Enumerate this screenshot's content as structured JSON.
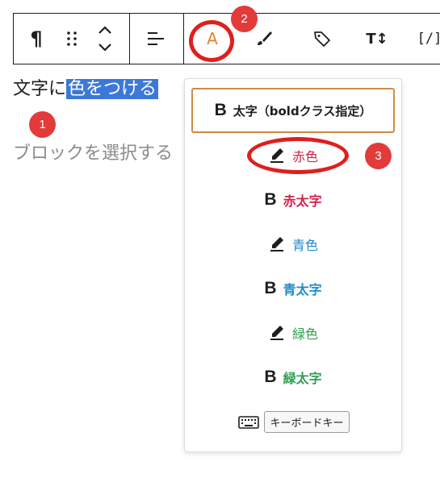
{
  "toolbar": {
    "paragraph_glyph": "¶",
    "highlight_glyph": "A",
    "tt_glyph": "T↕",
    "code_glyph": "[/]"
  },
  "editor": {
    "text_before": "文字に",
    "text_selected": "色をつける",
    "placeholder": "ブロックを選択する"
  },
  "badges": {
    "one": "1",
    "two": "2",
    "three": "3"
  },
  "menu": {
    "items": [
      {
        "label": "太字（boldクラス指定）",
        "icon": "bold-B",
        "color": "#1e1e1e"
      },
      {
        "label": "赤色",
        "icon": "pen-icon",
        "color": "#d6204a"
      },
      {
        "label": "赤太字",
        "icon": "bold-B",
        "color": "#d6204a"
      },
      {
        "label": "青色",
        "icon": "pen-icon",
        "color": "#1f8ac9"
      },
      {
        "label": "青太字",
        "icon": "bold-B",
        "color": "#1f8ac9"
      },
      {
        "label": "緑色",
        "icon": "pen-icon",
        "color": "#2e9e4f"
      },
      {
        "label": "緑太字",
        "icon": "bold-B",
        "color": "#2e9e4f"
      }
    ],
    "bold_glyph": "B",
    "keyboard_label": "キーボードキー"
  },
  "colors": {
    "accent_orange": "#e0842c",
    "annotation_red": "#e01e1e",
    "selection_blue": "#3b78d8"
  }
}
